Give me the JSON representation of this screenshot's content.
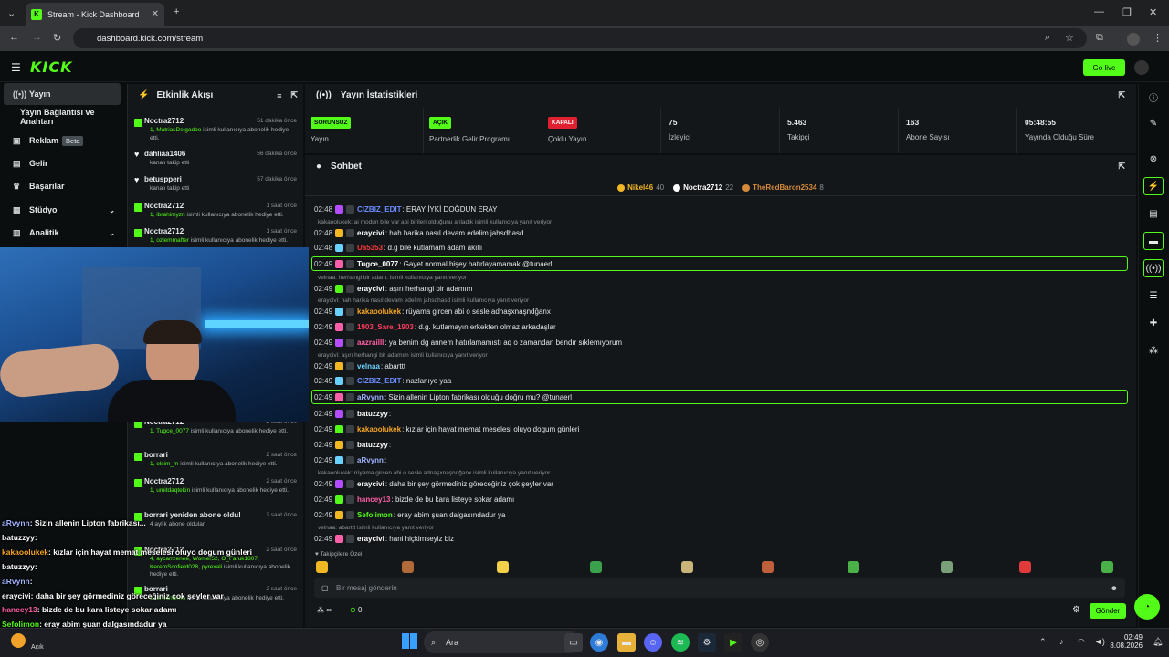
{
  "browser": {
    "tab_title": "Stream - Kick Dashboard",
    "url": "dashboard.kick.com/stream"
  },
  "header": {
    "logo": "KICK",
    "go_live": "Go live"
  },
  "nav": {
    "items": [
      {
        "label": "Yayın",
        "icon": "live-icon"
      },
      {
        "label": "Yayın Bağlantısı ve Anahtarı"
      },
      {
        "label": "Reklam",
        "badge": "Beta",
        "icon": "ad-icon"
      },
      {
        "label": "Gelir",
        "icon": "revenue-icon"
      },
      {
        "label": "Başarılar",
        "icon": "trophy-icon"
      },
      {
        "label": "Stüdyo",
        "icon": "studio-icon"
      },
      {
        "label": "Analitik",
        "icon": "analytics-icon"
      }
    ]
  },
  "activity": {
    "title": "Etkinlik Akışı",
    "items": [
      {
        "name": "Noctra2712",
        "time": "51 dakika önce",
        "sub_hl": "1, MatriasDelgadoo",
        "sub": " isimli kullanıcıya abonelik hediye etti."
      },
      {
        "name": "dahliaa1406",
        "time": "56 dakika önce",
        "sub_hl": "",
        "sub": "kanalı takip etti"
      },
      {
        "name": "betuspperi",
        "time": "57 dakika önce",
        "sub_hl": "",
        "sub": "kanalı takip etti"
      },
      {
        "name": "Noctra2712",
        "time": "1 saat önce",
        "sub_hl": "1, ibrahimyzn",
        "sub": " isimli kullanıcıya abonelik hediye etti."
      },
      {
        "name": "Noctra2712",
        "time": "1 saat önce",
        "sub_hl": "1, ozlemmafter",
        "sub": " isimli kullanıcıya abonelik hediye etti."
      },
      {
        "name": "Noctra2712",
        "time": "2 saat önce",
        "sub_hl": "1, Tugce_0077",
        "sub": " isimli kullanıcıya abonelik hediye etti."
      },
      {
        "name": "borrari",
        "time": "2 saat önce",
        "sub_hl": "1, elsim_m",
        "sub": " isimli kullanıcıya abonelik hediye etti."
      },
      {
        "name": "Noctra2712",
        "time": "2 saat önce",
        "sub_hl": "1, umitdaqtekin",
        "sub": " isimli kullanıcıya abonelik hediye etti."
      },
      {
        "name": "borrari yeniden abone oldu!",
        "time": "2 saat önce",
        "sub_hl": "",
        "sub": "4 aylık abone oldular"
      },
      {
        "name": "Noctra2712",
        "time": "2 saat önce",
        "sub_hl": "4, aycarrzenee, Womer52, O_Faruk1807, KeremScofield028, pyrexali",
        "sub": " isimli kullanıcıya abonelik hediye etti."
      },
      {
        "name": "borrari",
        "time": "2 saat önce",
        "sub_hl": "1, brwcndmm",
        "sub": " isimli kullanıcıya abonelik hediye etti."
      }
    ]
  },
  "stats": {
    "title": "Yayın İstatistikleri",
    "cards": [
      {
        "value": "SORUNSUZ",
        "label": "Yayın",
        "pill_color": "#53fc18"
      },
      {
        "value": "AÇIK",
        "label": "Partnerlik Gelir Programı",
        "pill_color": "#53fc18"
      },
      {
        "value": "KAPALI",
        "label": "Çoklu Yayın",
        "pill_color": "#e0202f"
      },
      {
        "value": "75",
        "label": "İzleyici"
      },
      {
        "value": "5.463",
        "label": "Takipçi"
      },
      {
        "value": "163",
        "label": "Abone Sayısı"
      },
      {
        "value": "05:48:55",
        "label": "Yayında Olduğu Süre"
      }
    ]
  },
  "chat": {
    "title": "Sohbet",
    "leaders": [
      {
        "name": "Nikel46",
        "count": "40",
        "color": "#f2b824"
      },
      {
        "name": "Noctra2712",
        "count": "22",
        "color": "#ffffff"
      },
      {
        "name": "TheRedBaron2534",
        "count": "8",
        "color": "#d68a3a"
      }
    ],
    "messages": [
      {
        "time": "02:48",
        "user": "CIZBIZ_EDIT",
        "color": "#6b8cff",
        "text": ": ERAY İYKİ DOĞDUN ERAY"
      },
      {
        "reply": "kakaoolukek: ai modun bile var abi birileri olduğunu anladık isimli kullanıcıya yanıt veriyor"
      },
      {
        "time": "02:48",
        "user": "eraycivi",
        "color": "#ffffff",
        "text": ": hah harika nasıl devam edelim jahsdhasd"
      },
      {
        "time": "02:48",
        "user": "Ua5353",
        "color": "#ff3b3b",
        "text": ": d.g bile kutlamam adam akıllı"
      },
      {
        "time": "02:49",
        "user": "Tugce_0077",
        "color": "#ffffff",
        "text": ": Gayet normal bişey hatırlayamamak @tunaerl",
        "hl": true
      },
      {
        "reply": "velnaa: herhangi bir adam. isimli kullanıcıya yanıt veriyor"
      },
      {
        "time": "02:49",
        "user": "eraycivi",
        "color": "#ffffff",
        "text": ": aşırı herhangi bir adamım"
      },
      {
        "reply": "eraycivi: hah harika nasıl devam edelim jahsdhasd isimli kullanıcıya yanıt veriyor"
      },
      {
        "time": "02:49",
        "user": "kakaoolukek",
        "color": "#f5a524",
        "text": ": rüyama gircen abi o sesle adnaşxnaşndğanx"
      },
      {
        "time": "02:49",
        "user": "1903_Sare_1903",
        "color": "#ff3b5c",
        "text": ": d.g. kutlamayın erkekten olmaz arkadaşlar"
      },
      {
        "time": "02:49",
        "user": "aazrailll",
        "color": "#ff5fa8",
        "text": ": ya benim dg annem hatırlamamıstı aq o zamandan bendır sıklemıyorum"
      },
      {
        "reply": "eraycivi: aşırı herhangi bir adamım isimli kullanıcıya yanıt veriyor"
      },
      {
        "time": "02:49",
        "user": "velnaa",
        "color": "#6ad0ff",
        "text": ": abarttt"
      },
      {
        "time": "02:49",
        "user": "CIZBIZ_EDIT",
        "color": "#6b8cff",
        "text": ": nazlanıyo yaa"
      },
      {
        "time": "02:49",
        "user": "aRvynn",
        "color": "#9fb4ff",
        "text": ": Sizin allenin Lipton fabrikası olduğu doğru mu? @tunaerl",
        "hl": true
      },
      {
        "time": "02:49",
        "user": "batuzzyy",
        "color": "#ffffff",
        "text": ":"
      },
      {
        "time": "02:49",
        "user": "kakaoolukek",
        "color": "#f5a524",
        "text": ": kızlar için hayat memat meselesi oluyo dogum günleri"
      },
      {
        "time": "02:49",
        "user": "batuzzyy",
        "color": "#ffffff",
        "text": ":"
      },
      {
        "time": "02:49",
        "user": "aRvynn",
        "color": "#9fb4ff",
        "text": ":"
      },
      {
        "reply": "kakaoolukek: rüyama gircen abi o sesle adnaşxnaşndğanx isimli kullanıcıya yanıt veriyor"
      },
      {
        "time": "02:49",
        "user": "eraycivi",
        "color": "#ffffff",
        "text": ": daha bir şey görmediniz göreceğiniz çok şeyler var"
      },
      {
        "time": "02:49",
        "user": "hancey13",
        "color": "#ff5fa8",
        "text": ": bizde de bu kara listeye sokar adamı"
      },
      {
        "time": "02:49",
        "user": "Sefolimon",
        "color": "#53fc18",
        "text": ": eray abim şuan dalgasındadur ya"
      },
      {
        "reply": "velnaa: abarttt isimli kullanıcıya yanıt veriyor"
      },
      {
        "time": "02:49",
        "user": "eraycivi",
        "color": "#ffffff",
        "text": ": hani hiçkimseyiz biz"
      }
    ],
    "emote_section": "Takipçilere Özel",
    "input_placeholder": "Bir mesaj gönderin",
    "send": "Gönder",
    "points": "0"
  },
  "overlay_chat": [
    {
      "user": "aRvynn",
      "text": ": Sizin allenin Lipton fabrikası...",
      "color": "#9fb4ff"
    },
    {
      "user": "batuzzyy",
      "text": ":",
      "color": "#ffffff"
    },
    {
      "user": "kakaoolukek",
      "text": ": kızlar için hayat memat meselesi oluyo dogum günleri",
      "color": "#f5a524"
    },
    {
      "user": "batuzzyy",
      "text": ":",
      "color": "#ffffff"
    },
    {
      "user": "aRvynn",
      "text": ":",
      "color": "#9fb4ff"
    },
    {
      "user": "eraycivi",
      "text": ": daha bir şey görmediniz göreceğiniz çok şeyler var",
      "color": "#ffffff"
    },
    {
      "user": "hancey13",
      "text": ": bizde de bu kara listeye sokar adamı",
      "color": "#ff5fa8"
    },
    {
      "user": "Sefolimon",
      "text": ": eray abim şuan dalgasındadur ya",
      "color": "#53fc18"
    },
    {
      "user": "eraycivi",
      "text": ": hani hiçkimseyiz biz",
      "color": "#ffffff"
    }
  ],
  "taskbar": {
    "weather": "Açık",
    "search": "Ara",
    "time": "02:49",
    "date": "8.08.2026"
  }
}
